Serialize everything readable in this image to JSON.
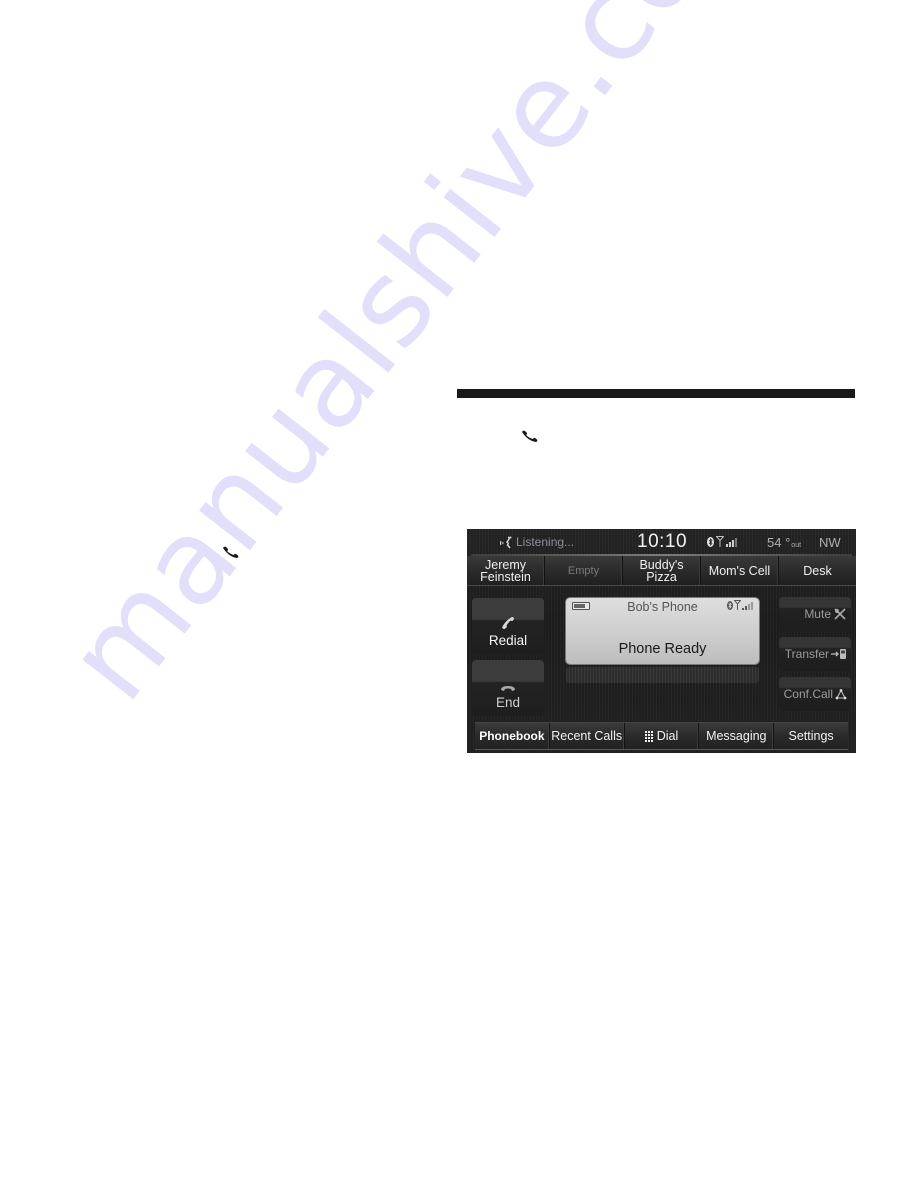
{
  "document": {
    "watermark": "manualshive.com",
    "icons": {
      "handset_inline_1": "phone-handset-icon",
      "handset_inline_2": "phone-handset-icon"
    }
  },
  "screen": {
    "status_bar": {
      "voice_status": "Listening...",
      "clock": "10:10",
      "temperature": "54",
      "temperature_unit": "°",
      "temperature_suffix": "out",
      "compass": "NW",
      "icons": [
        "voice-command-icon",
        "bluetooth-icon",
        "antenna-icon",
        "signal-strength-icon"
      ]
    },
    "presets": [
      {
        "label_line1": "Jeremy",
        "label_line2": "Feinstein",
        "empty": false
      },
      {
        "label_line1": "Empty",
        "label_line2": "",
        "empty": true
      },
      {
        "label_line1": "Buddy's",
        "label_line2": "Pizza",
        "empty": false
      },
      {
        "label_line1": "Mom's Cell",
        "label_line2": "",
        "empty": false
      },
      {
        "label_line1": "Desk",
        "label_line2": "",
        "empty": false
      }
    ],
    "left_buttons": {
      "redial": {
        "label": "Redial",
        "icon": "phone-handset-icon"
      },
      "end": {
        "label": "End",
        "icon": "hang-up-icon"
      }
    },
    "phone_panel": {
      "phone_name": "Bob's Phone",
      "status": "Phone Ready",
      "icons": [
        "battery-icon",
        "bluetooth-icon",
        "signal-strength-icon"
      ]
    },
    "right_buttons": {
      "mute": {
        "label": "Mute",
        "icon": "mute-mic-icon"
      },
      "transfer": {
        "label": "Transfer",
        "icon": "transfer-to-phone-icon"
      },
      "conference": {
        "label": "Conf.Call",
        "icon": "conference-call-icon"
      }
    },
    "bottom_nav": [
      {
        "label": "Phonebook",
        "icon": ""
      },
      {
        "label": "Recent Calls",
        "icon": ""
      },
      {
        "label": "Dial",
        "icon": "dialpad-icon"
      },
      {
        "label": "Messaging",
        "icon": ""
      },
      {
        "label": "Settings",
        "icon": ""
      }
    ]
  }
}
